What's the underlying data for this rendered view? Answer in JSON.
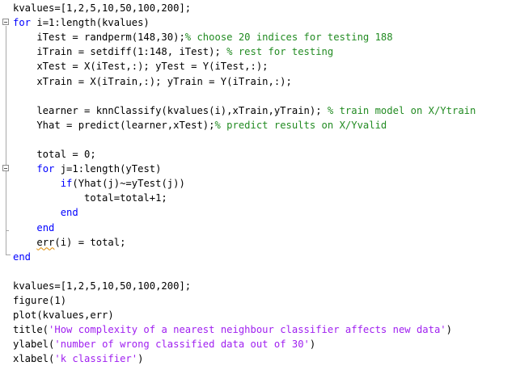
{
  "editor": {
    "lines": [
      [
        [
          "n",
          "kvalues=[1,2,5,10,50,100,200];"
        ]
      ],
      [
        [
          "k",
          "for "
        ],
        [
          "n",
          "i=1:length(kvalues)"
        ]
      ],
      [
        [
          "n",
          "    iTest = randperm(148,30);"
        ],
        [
          "c",
          "% choose 20 indices for testing 188"
        ]
      ],
      [
        [
          "n",
          "    iTrain = setdiff(1:148, iTest); "
        ],
        [
          "c",
          "% rest for testing"
        ]
      ],
      [
        [
          "n",
          "    xTest = X(iTest,:); yTest = Y(iTest,:);"
        ]
      ],
      [
        [
          "n",
          "    xTrain = X(iTrain,:); yTrain = Y(iTrain,:);"
        ]
      ],
      [],
      [
        [
          "n",
          "    learner = knnClassify(kvalues(i),xTrain,yTrain); "
        ],
        [
          "c",
          "% train model on X/Ytrain"
        ]
      ],
      [
        [
          "n",
          "    Yhat = predict(learner,xTest);"
        ],
        [
          "c",
          "% predict results on X/Yvalid"
        ]
      ],
      [],
      [
        [
          "n",
          "    total = 0;"
        ]
      ],
      [
        [
          "n",
          "    "
        ],
        [
          "k",
          "for "
        ],
        [
          "n",
          "j=1:length(yTest)"
        ]
      ],
      [
        [
          "n",
          "        "
        ],
        [
          "k",
          "if"
        ],
        [
          "n",
          "(Yhat(j)~=yTest(j))"
        ]
      ],
      [
        [
          "n",
          "            total=total+1;"
        ]
      ],
      [
        [
          "n",
          "        "
        ],
        [
          "k",
          "end"
        ]
      ],
      [
        [
          "n",
          "    "
        ],
        [
          "k",
          "end"
        ]
      ],
      [
        [
          "n",
          "    "
        ],
        [
          "u",
          "err"
        ],
        [
          "n",
          "(i) = total;"
        ]
      ],
      [
        [
          "k",
          "end"
        ]
      ],
      [],
      [
        [
          "n",
          "kvalues=[1,2,5,10,50,100,200];"
        ]
      ],
      [
        [
          "n",
          "figure(1)"
        ]
      ],
      [
        [
          "n",
          "plot(kvalues,err)"
        ]
      ],
      [
        [
          "n",
          "title("
        ],
        [
          "s",
          "'How complexity of a nearest neighbour classifier affects new data'"
        ],
        [
          "n",
          ")"
        ]
      ],
      [
        [
          "n",
          "ylabel("
        ],
        [
          "s",
          "'number of wrong classified data out of 30'"
        ],
        [
          "n",
          ")"
        ]
      ],
      [
        [
          "n",
          "xlabel("
        ],
        [
          "s",
          "'k classifier'"
        ],
        [
          "n",
          ")"
        ]
      ]
    ]
  }
}
